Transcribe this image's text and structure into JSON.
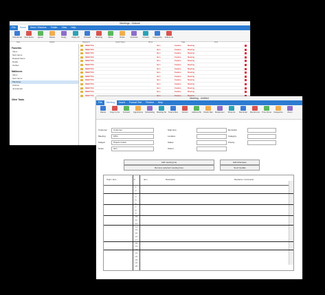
{
  "w1": {
    "title": "Meetings - Outlook",
    "menu": [
      "File",
      "Home",
      "Send / Receive",
      "Folder",
      "View",
      "Help"
    ],
    "ribbon": [
      "New Email",
      "New Items",
      "Ignore",
      "Delete",
      "Reply",
      "Reply All",
      "Forward",
      "Meeting",
      "Move",
      "Rules",
      "OneNote",
      "Unread",
      "Categorize",
      "Follow Up"
    ],
    "groups": [
      "New",
      "Delete",
      "Respond",
      "Quick Steps",
      "Move",
      "Tags",
      "Find"
    ],
    "nav": {
      "favorites_head": "Favorites",
      "favorites": [
        "Inbox",
        "Sent Items",
        "Deleted Items",
        "Drafts",
        "Outbox"
      ],
      "mail_head": "Mailboxes",
      "folders": [
        "Inbox",
        "Sent Items",
        "Meetings",
        "Archive",
        "Junk Email"
      ],
      "footer": "Other Tasks"
    },
    "rows": [
      {
        "from": "MEETING",
        "c1": "Item",
        "c2": "Feature",
        "c3": "Meeting"
      },
      {
        "from": "MEETING",
        "c1": "Item",
        "c2": "Feature",
        "c3": "Meeting"
      },
      {
        "from": "MEETING",
        "c1": "Item",
        "c2": "Feature",
        "c3": "Meeting"
      },
      {
        "from": "MEETING",
        "c1": "Item",
        "c2": "Feature",
        "c3": "Meeting"
      },
      {
        "from": "MEETING",
        "c1": "Item",
        "c2": "Feature",
        "c3": "Meeting"
      },
      {
        "from": "MEETING",
        "c1": "Item",
        "c2": "Feature",
        "c3": "Meeting"
      },
      {
        "from": "MEETING",
        "c1": "Item",
        "c2": "Feature",
        "c3": "Meeting"
      },
      {
        "from": "MEETING",
        "c1": "Item",
        "c2": "Feature",
        "c3": "Meeting"
      },
      {
        "from": "MEETING",
        "c1": "Item",
        "c2": "Feature",
        "c3": "Meeting"
      },
      {
        "from": "MEETING",
        "c1": "Item",
        "c2": "Feature",
        "c3": "Meeting"
      },
      {
        "from": "MEETING",
        "c1": "Item",
        "c2": "Feature",
        "c3": "Meeting"
      },
      {
        "from": "MEETING",
        "c1": "Item",
        "c2": "Feature",
        "c3": "Meeting"
      },
      {
        "from": "MEETING",
        "c1": "Item",
        "c2": "Feature",
        "c3": "Meeting"
      },
      {
        "from": "MEETING",
        "c1": "Item",
        "c2": "Feature",
        "c3": "Meeting"
      }
    ]
  },
  "w2": {
    "title": "Meeting - Untitled",
    "menu": [
      "File",
      "Meeting",
      "Insert",
      "Format Text",
      "Review",
      "Help"
    ],
    "ribbon": [
      "Delete",
      "Copy to Calendar",
      "Forward",
      "Appointment",
      "Scheduling",
      "Meeting Notes",
      "Teams Meeting",
      "Cancel",
      "Address Book",
      "Check Names",
      "Response Options",
      "Show As",
      "Reminder",
      "Recurrence",
      "Time Zones",
      "Categorize",
      "Zoom"
    ],
    "form": {
      "rows": [
        {
          "label": "Customer",
          "value": "Customer"
        },
        {
          "label": "Meeting",
          "value": "MTG"
        },
        {
          "label": "Subject",
          "value": "Project review"
        },
        {
          "label": "Notes",
          "value": "Item"
        }
      ],
      "mid_labels": [
        "Start time",
        "Location",
        "Status",
        "Owner"
      ],
      "right_labels": [
        "Reminder",
        "Category",
        "Priority"
      ],
      "btn_add": "Add meeting line",
      "btn_remove": "Remove selected meeting lines",
      "btn_right1": "Edit Attendees",
      "btn_right2": "Send Update"
    },
    "grid": {
      "headers": [
        "Topic / Item",
        "#",
        "Item",
        "Description",
        "Decisions / Comments"
      ],
      "row_numbers": [
        "1",
        "2",
        "3",
        "4",
        "5",
        "6",
        "7",
        "8",
        "9",
        "10",
        "11",
        "12",
        "13",
        "14",
        "15",
        "16",
        "17",
        "18",
        "19",
        "20",
        "21",
        "22",
        "23",
        "24",
        "25"
      ]
    }
  }
}
